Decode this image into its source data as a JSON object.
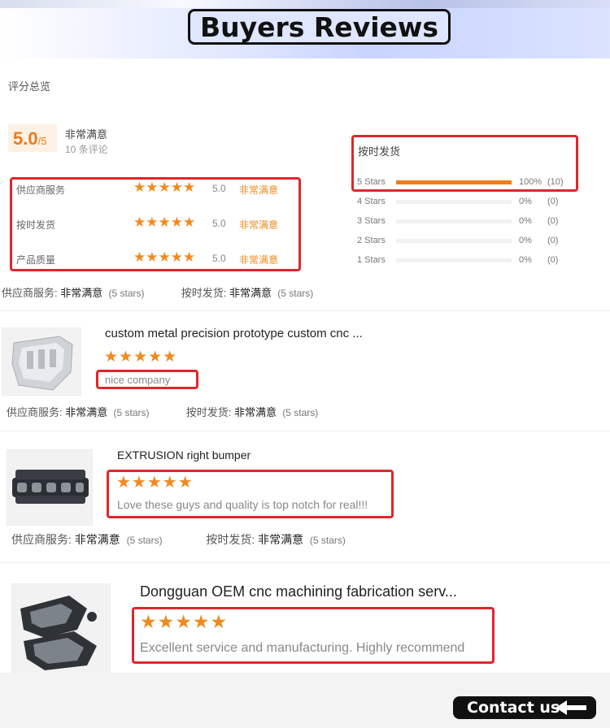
{
  "banner": {
    "title": "Buyers Reviews"
  },
  "summary": {
    "title": "评分总览",
    "score": "5.0",
    "score_max": "/5",
    "desc": "非常满意",
    "count": "10 条评论",
    "ratings": [
      {
        "label": "供应商服务",
        "stars": "★★★★★",
        "value": "5.0",
        "word": "非常满意"
      },
      {
        "label": "按时发货",
        "stars": "★★★★★",
        "value": "5.0",
        "word": "非常满意"
      },
      {
        "label": "产品质量",
        "stars": "★★★★★",
        "value": "5.0",
        "word": "非常满意"
      }
    ],
    "dist_title": "按时发货",
    "distribution": [
      {
        "label": "5 Stars",
        "fraction": 1.0,
        "pct": "100%",
        "count": "(10)"
      },
      {
        "label": "4 Stars",
        "fraction": 0,
        "pct": "0%",
        "count": "(0)"
      },
      {
        "label": "3 Stars",
        "fraction": 0,
        "pct": "0%",
        "count": "(0)"
      },
      {
        "label": "2 Stars",
        "fraction": 0,
        "pct": "0%",
        "count": "(0)"
      },
      {
        "label": "1 Stars",
        "fraction": 0,
        "pct": "0%",
        "count": "(0)"
      }
    ],
    "foot": {
      "service_label": "供应商服务:",
      "service_value": "非常满意",
      "service_stars": "(5 stars)",
      "ship_label": "按时发货:",
      "ship_value": "非常满意",
      "ship_stars": "(5 stars)"
    }
  },
  "reviews": [
    {
      "title": "custom metal precision prototype custom cnc ...",
      "stars": "★★★★★",
      "comment": "nice company",
      "service_label": "供应商服务:",
      "service_value": "非常满意",
      "service_stars": "(5 stars)",
      "ship_label": "按时发货:",
      "ship_value": "非常满意",
      "ship_stars": "(5 stars)"
    },
    {
      "title": "EXTRUSION right bumper",
      "stars": "★★★★★",
      "comment": "Love these guys and quality is top notch for real!!!",
      "service_label": "供应商服务:",
      "service_value": "非常满意",
      "service_stars": "(5 stars)",
      "ship_label": "按时发货:",
      "ship_value": "非常满意",
      "ship_stars": "(5 stars)"
    },
    {
      "title": "Dongguan OEM cnc machining fabrication serv...",
      "stars": "★★★★★",
      "comment": "Excellent service and manufacturing. Highly recommend"
    }
  ],
  "contact": {
    "label": "Contact us"
  },
  "colors": {
    "accent": "#f08a1f",
    "highlight_border": "#e0262b"
  }
}
